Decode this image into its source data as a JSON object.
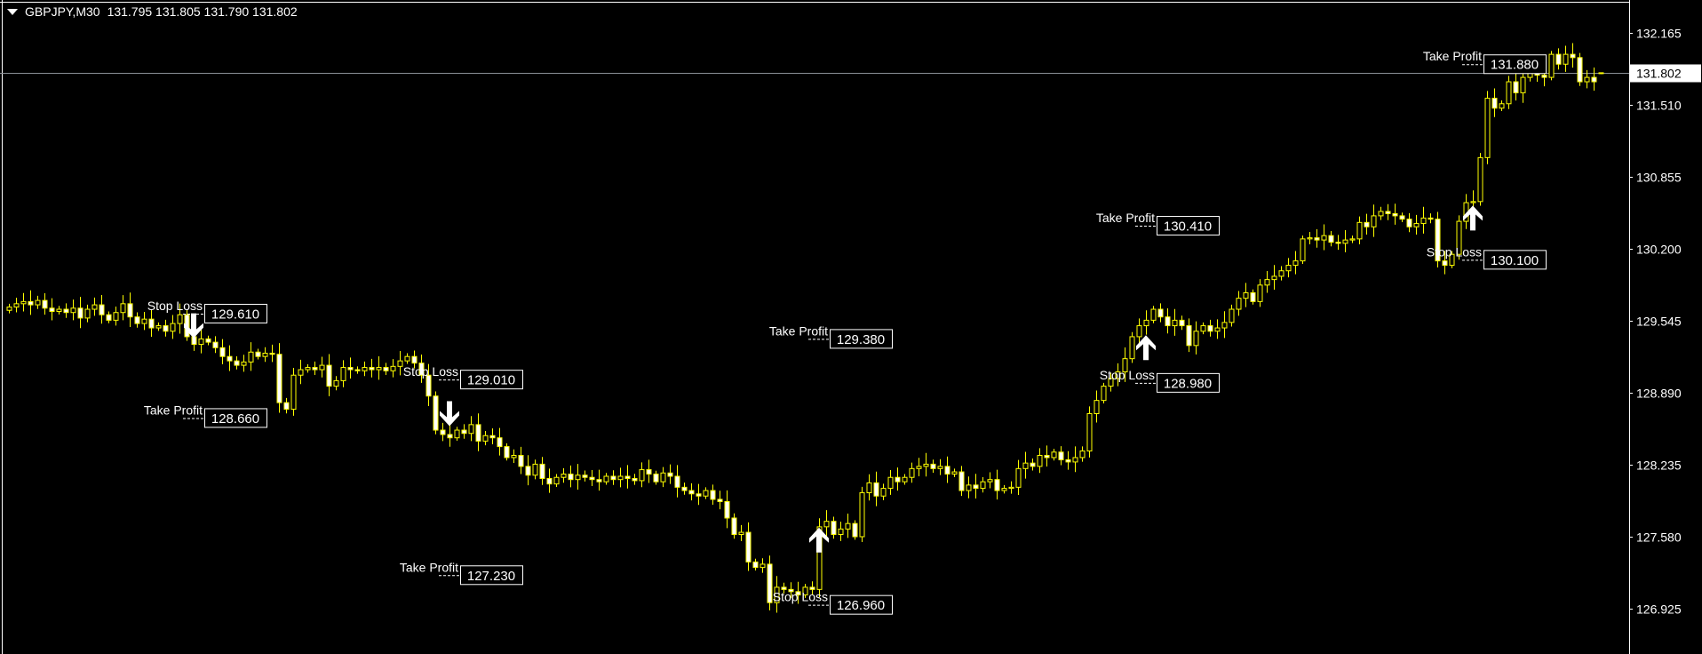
{
  "header": {
    "symbol": "GBPJPY,M30",
    "ohlc_text": "131.795 131.805 131.790 131.802"
  },
  "colors": {
    "background": "#000000",
    "candle": "#ffff00",
    "bear_body": "#ffffff",
    "bull_body": "#000000",
    "text": "#ffffff",
    "price_line": "#8a8f96"
  },
  "chart_data": {
    "type": "candlestick",
    "title": "GBPJPY,M30",
    "ylim": [
      126.75,
      132.6
    ],
    "y_ticks": [
      132.165,
      131.51,
      130.855,
      130.2,
      129.545,
      128.89,
      128.235,
      127.58,
      126.925
    ],
    "y_tick_labels": [
      "132.165",
      "131.510",
      "130.855",
      "130.200",
      "129.545",
      "128.890",
      "128.235",
      "127.580",
      "126.925"
    ],
    "current_price": 131.802,
    "current_price_label": "131.802",
    "last_candle": {
      "open": 131.795,
      "high": 131.805,
      "low": 131.79,
      "close": 131.802
    },
    "close": [
      129.67,
      129.7,
      129.72,
      129.69,
      129.73,
      129.66,
      129.63,
      129.65,
      129.62,
      129.66,
      129.57,
      129.65,
      129.69,
      129.6,
      129.55,
      129.62,
      129.7,
      129.58,
      129.52,
      129.56,
      129.48,
      129.5,
      129.45,
      129.52,
      129.6,
      129.4,
      129.33,
      129.38,
      129.35,
      129.3,
      129.22,
      129.18,
      129.14,
      129.17,
      129.26,
      129.22,
      129.25,
      129.24,
      128.8,
      128.74,
      129.05,
      129.1,
      129.12,
      129.1,
      129.14,
      128.95,
      129.0,
      129.12,
      129.1,
      129.09,
      129.12,
      129.1,
      129.12,
      129.09,
      129.13,
      129.18,
      129.22,
      129.16,
      129.05,
      128.86,
      128.55,
      128.51,
      128.48,
      128.55,
      128.52,
      128.6,
      128.45,
      128.5,
      128.48,
      128.4,
      128.3,
      128.32,
      128.22,
      128.14,
      128.24,
      128.11,
      128.06,
      128.12,
      128.15,
      128.1,
      128.14,
      128.12,
      128.1,
      128.08,
      128.13,
      128.1,
      128.13,
      128.11,
      128.09,
      128.19,
      128.15,
      128.08,
      128.16,
      128.13,
      128.03,
      128.0,
      127.97,
      127.95,
      128.0,
      127.92,
      127.9,
      127.75,
      127.6,
      127.62,
      127.35,
      127.3,
      127.33,
      126.98,
      127.12,
      127.1,
      127.08,
      127.05,
      127.12,
      127.1,
      127.67,
      127.72,
      127.6,
      127.65,
      127.7,
      127.58,
      127.98,
      128.07,
      127.95,
      128.02,
      128.12,
      128.08,
      128.12,
      128.2,
      128.22,
      128.24,
      128.2,
      128.22,
      128.15,
      128.17,
      128.0,
      128.05,
      128.02,
      128.08,
      128.1,
      128.0,
      128.02,
      128.03,
      128.2,
      128.25,
      128.22,
      128.32,
      128.3,
      128.35,
      128.28,
      128.26,
      128.3,
      128.36,
      128.7,
      128.82,
      128.95,
      129.02,
      129.08,
      129.2,
      129.4,
      129.5,
      129.55,
      129.65,
      129.58,
      129.5,
      129.55,
      129.5,
      129.32,
      129.45,
      129.5,
      129.45,
      129.48,
      129.53,
      129.65,
      129.75,
      129.8,
      129.72,
      129.87,
      129.92,
      129.95,
      130.0,
      130.05,
      130.09,
      130.29,
      130.3,
      130.28,
      130.32,
      130.26,
      130.25,
      130.28,
      130.29,
      130.44,
      130.4,
      130.5,
      130.54,
      130.52,
      130.5,
      130.47,
      130.4,
      130.43,
      130.48,
      130.47,
      130.09,
      130.05,
      130.15,
      130.45,
      130.62,
      130.63,
      131.03,
      131.57,
      131.48,
      131.52,
      131.72,
      131.62,
      131.76,
      131.8,
      131.78,
      131.76,
      131.97,
      131.88,
      131.97,
      131.94,
      131.72,
      131.76,
      131.72,
      131.802
    ],
    "trades": [
      {
        "direction": "sell",
        "bar": 26,
        "entry": 129.5,
        "stop_loss": {
          "label": "Stop Loss",
          "value": "129.610"
        },
        "take_profit": {
          "label": "Take Profit",
          "value": "128.660"
        }
      },
      {
        "direction": "sell",
        "bar": 62,
        "entry": 128.7,
        "stop_loss": {
          "label": "Stop Loss",
          "value": "129.010"
        },
        "take_profit": {
          "label": "Take Profit",
          "value": "127.230"
        }
      },
      {
        "direction": "buy",
        "bar": 114,
        "entry": 127.55,
        "stop_loss": {
          "label": "Stop Loss",
          "value": "126.960"
        },
        "take_profit": {
          "label": "Take Profit",
          "value": "129.380"
        }
      },
      {
        "direction": "buy",
        "bar": 160,
        "entry": 129.3,
        "stop_loss": {
          "label": "Stop Loss",
          "value": "128.980"
        },
        "take_profit": {
          "label": "Take Profit",
          "value": "130.410"
        }
      },
      {
        "direction": "buy",
        "bar": 206,
        "entry": 130.48,
        "stop_loss": {
          "label": "Stop Loss",
          "value": "130.100"
        },
        "take_profit": {
          "label": "Take Profit",
          "value": "131.880"
        }
      }
    ]
  }
}
